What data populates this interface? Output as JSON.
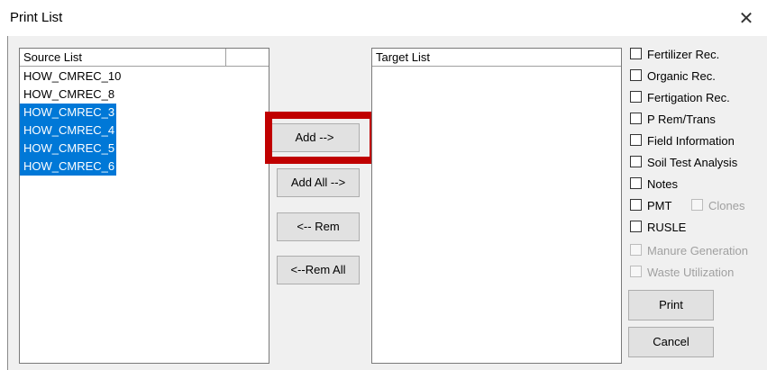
{
  "window": {
    "title": "Print List",
    "close_glyph": "✕"
  },
  "source_list": {
    "header": "Source List",
    "items": [
      {
        "label": "HOW_CMREC_10",
        "selected": false
      },
      {
        "label": "HOW_CMREC_8",
        "selected": false
      },
      {
        "label": "HOW_CMREC_3",
        "selected": true
      },
      {
        "label": "HOW_CMREC_4",
        "selected": true
      },
      {
        "label": "HOW_CMREC_5",
        "selected": true
      },
      {
        "label": "HOW_CMREC_6",
        "selected": true
      }
    ]
  },
  "target_list": {
    "header": "Target List",
    "items": []
  },
  "buttons": {
    "add": "Add  -->",
    "add_all": "Add  All  -->",
    "remove": "<-- Rem",
    "remove_all": "<--Rem All",
    "print": "Print",
    "cancel": "Cancel"
  },
  "options": [
    {
      "label": "Fertilizer Rec.",
      "checked": false,
      "enabled": true
    },
    {
      "label": "Organic Rec.",
      "checked": false,
      "enabled": true
    },
    {
      "label": "Fertigation Rec.",
      "checked": false,
      "enabled": true
    },
    {
      "label": "P Rem/Trans",
      "checked": false,
      "enabled": true
    },
    {
      "label": "Field Information",
      "checked": false,
      "enabled": true
    },
    {
      "label": "Soil Test Analysis",
      "checked": false,
      "enabled": true
    },
    {
      "label": "Notes",
      "checked": false,
      "enabled": true
    },
    {
      "label": "PMT",
      "checked": false,
      "enabled": true
    },
    {
      "label": "RUSLE",
      "checked": false,
      "enabled": true
    },
    {
      "label": "Manure Generation",
      "checked": false,
      "enabled": false
    },
    {
      "label": "Waste Utilization",
      "checked": false,
      "enabled": false
    }
  ],
  "clones_option": {
    "label": "Clones",
    "checked": false,
    "enabled": false
  },
  "annotation": {
    "highlight_color": "#c00000",
    "target": "add-button"
  },
  "colors": {
    "selection": "#0078d7",
    "dialog_bg": "#f0f0f0"
  }
}
